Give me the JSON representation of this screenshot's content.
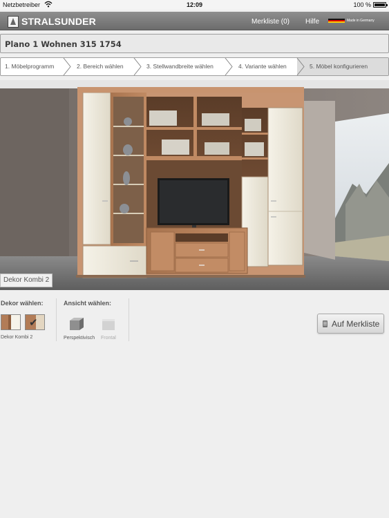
{
  "statusbar": {
    "carrier": "Netzbetreiber",
    "time": "12:09",
    "battery": "100 %"
  },
  "header": {
    "brand": "STRALSUNDER",
    "merkliste": "Merkliste (0)",
    "hilfe": "Hilfe",
    "made_in": "Made in Germany"
  },
  "title": "Plano 1 Wohnen 315 1754",
  "steps": [
    {
      "label": "1. Möbelprogramm"
    },
    {
      "label": "2. Bereich wählen"
    },
    {
      "label": "3. Stellwandbreite wählen"
    },
    {
      "label": "4. Variante wählen"
    },
    {
      "label": "5. Möbel konfigurieren",
      "active": true
    }
  ],
  "scene": {
    "dekor_label": "Dekor Kombi 2"
  },
  "options": {
    "dekor_heading": "Dekor wählen:",
    "dekor_caption": "Dekor Kombi 2",
    "ansicht_heading": "Ansicht wählen:",
    "views": [
      {
        "label": "Perspektivisch",
        "active": true
      },
      {
        "label": "Frontal",
        "active": false
      }
    ]
  },
  "button": {
    "merkliste": "Auf Merkliste"
  },
  "colors": {
    "header": "#7d7d7d",
    "wood": "#b27c57",
    "cream": "#eeeadc"
  }
}
